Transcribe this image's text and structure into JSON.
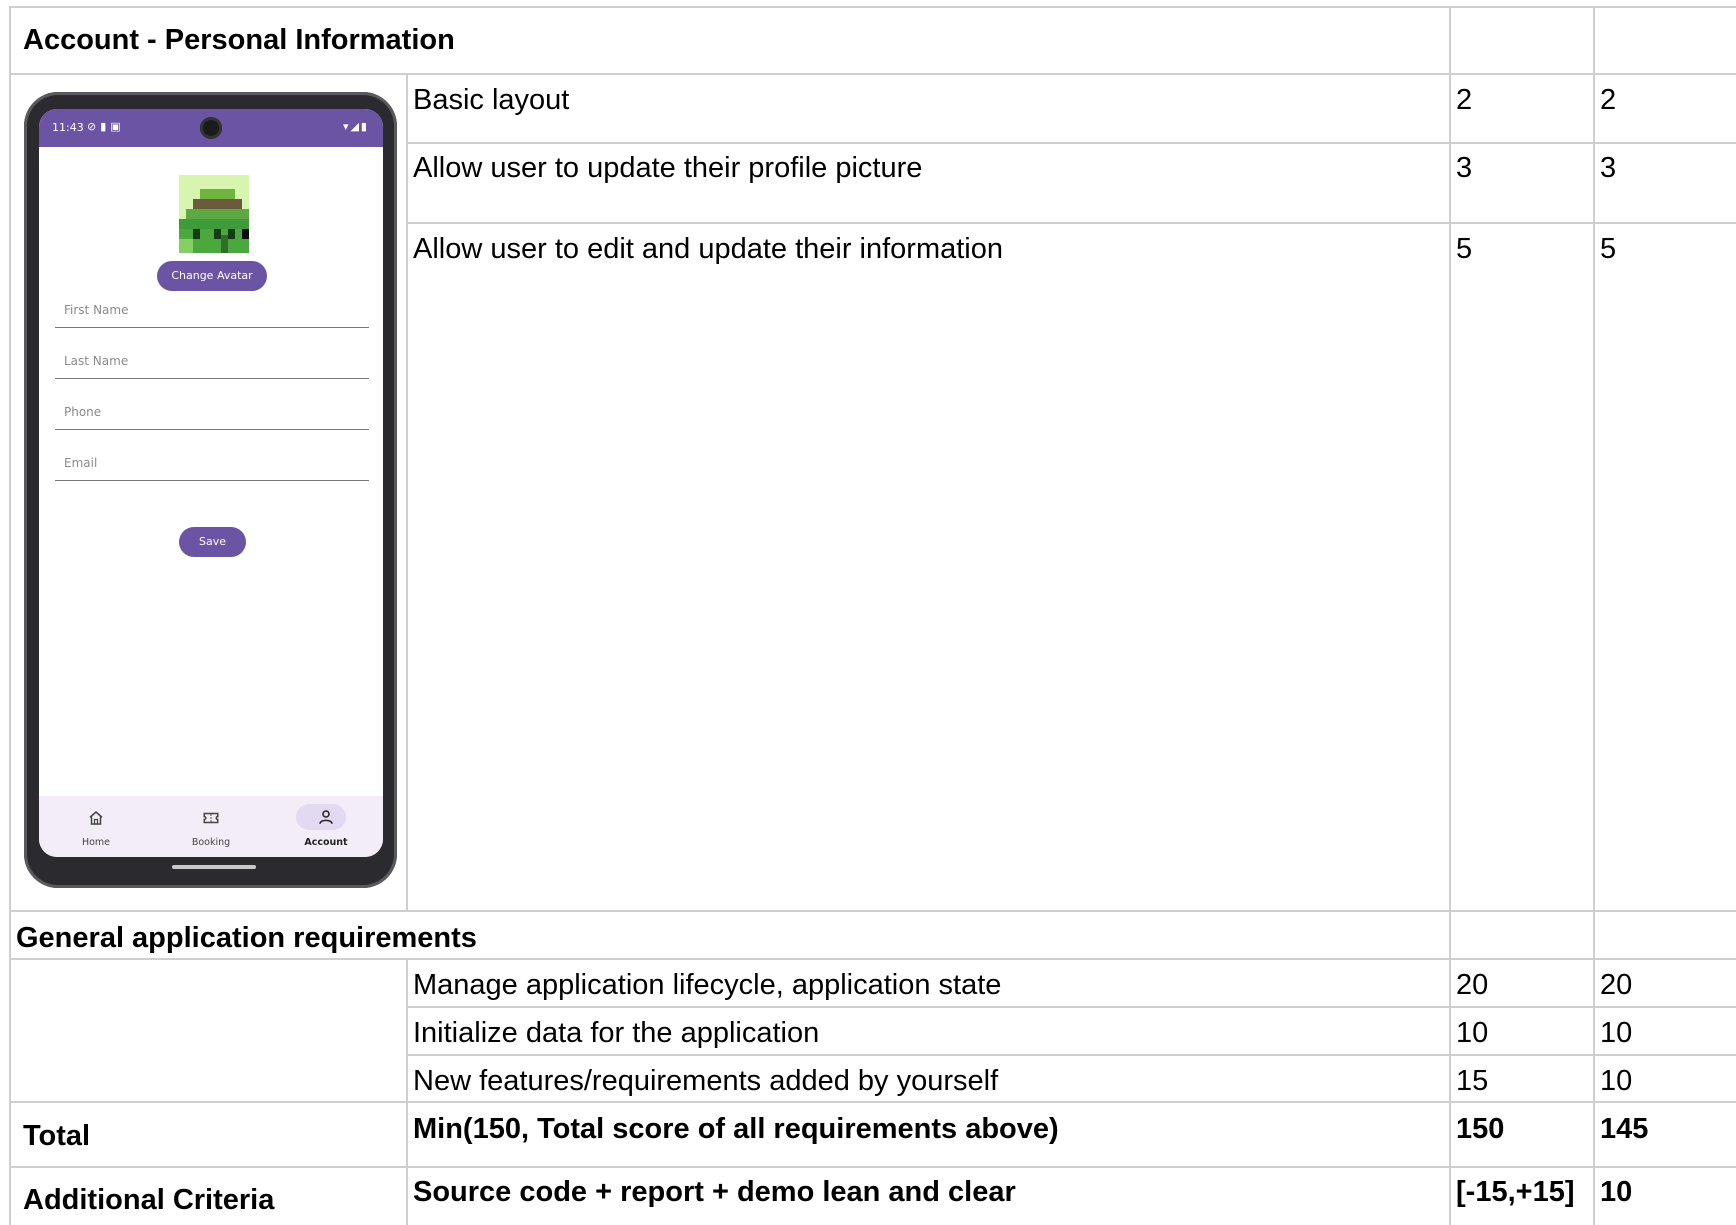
{
  "account_section": {
    "title": "Account - Personal Information",
    "rows": [
      {
        "requirement": "Basic layout",
        "max": "2",
        "score": "2"
      },
      {
        "requirement": "Allow user to update their profile picture",
        "max": "3",
        "score": "3"
      },
      {
        "requirement": "Allow user to edit and update their information",
        "max": "5",
        "score": "5"
      }
    ]
  },
  "phone": {
    "status_time": "11:43",
    "change_avatar_label": "Change Avatar",
    "fields": [
      {
        "placeholder": "First Name"
      },
      {
        "placeholder": "Last Name"
      },
      {
        "placeholder": "Phone"
      },
      {
        "placeholder": "Email"
      }
    ],
    "save_label": "Save",
    "nav": [
      {
        "label": "Home",
        "icon": "home-icon"
      },
      {
        "label": "Booking",
        "icon": "ticket-icon"
      },
      {
        "label": "Account",
        "icon": "person-icon",
        "selected": true
      }
    ],
    "colors": {
      "primary": "#6b54a3",
      "nav_background": "#f2edf7",
      "nav_selected": "#e3daf2"
    }
  },
  "general_section": {
    "title": "General application requirements",
    "rows": [
      {
        "requirement": "Manage application lifecycle, application state",
        "max": "20",
        "score": "20"
      },
      {
        "requirement": "Initialize data for the application",
        "max": "10",
        "score": "10"
      },
      {
        "requirement": "New features/requirements added by yourself",
        "max": "15",
        "score": "10"
      }
    ]
  },
  "total": {
    "label": "Total",
    "requirement": "Min(150, Total score of all requirements above)",
    "max": "150",
    "score": "145"
  },
  "additional": {
    "label": "Additional Criteria",
    "requirement": "Source code + report + demo lean and clear",
    "max": "[-15,+15]",
    "score": "10"
  }
}
